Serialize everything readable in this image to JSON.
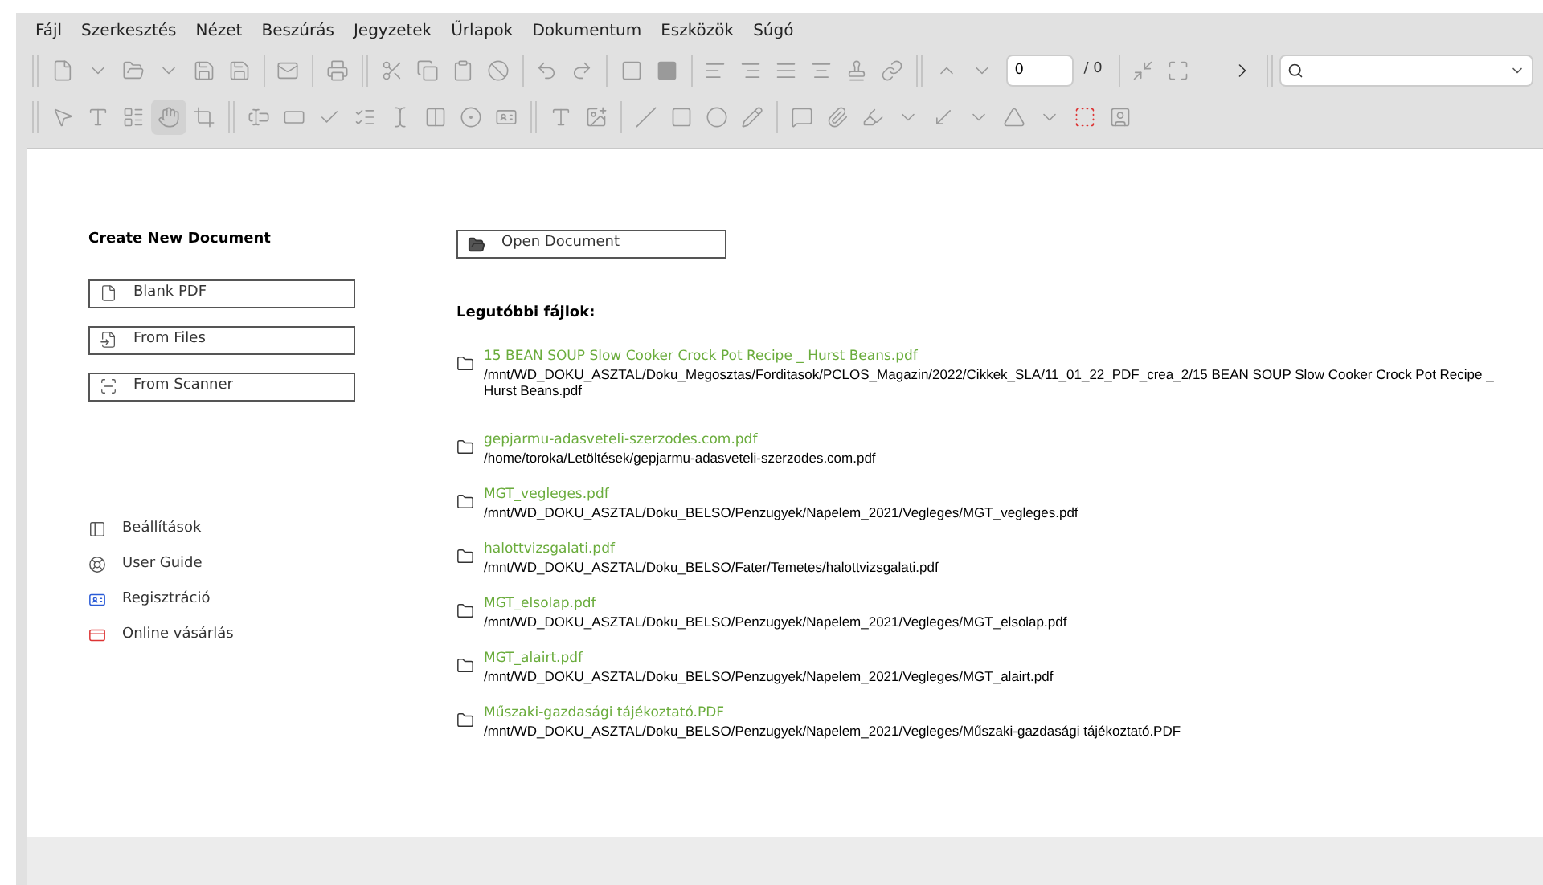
{
  "menu_bar": [
    "Fájl",
    "Szerkesztés",
    "Nézet",
    "Beszúrás",
    "Jegyzetek",
    "Űrlapok",
    "Dokumentum",
    "Eszközök",
    "Súgó"
  ],
  "toolbar": {
    "page_field": {
      "value": "0"
    },
    "page_total": "/ 0"
  },
  "create": {
    "title": "Create New Document",
    "buttons": [
      {
        "label": "Blank PDF",
        "kind": "blank"
      },
      {
        "label": "From Files",
        "kind": "files"
      },
      {
        "label": "From Scanner",
        "kind": "scanner"
      }
    ]
  },
  "links": [
    {
      "label": "Beállítások",
      "kind": "settings"
    },
    {
      "label": "User Guide",
      "kind": "guide"
    },
    {
      "label": "Regisztráció",
      "kind": "register"
    },
    {
      "label": "Online vásárlás",
      "kind": "buy"
    }
  ],
  "open_button": "Open Document",
  "recent": {
    "title": "Legutóbbi fájlok:",
    "files": [
      {
        "name": "15 BEAN SOUP Slow Cooker Crock Pot Recipe _ Hurst Beans.pdf",
        "path": "/mnt/WD_DOKU_ASZTAL/Doku_Megosztas/Forditasok/PCLOS_Magazin/2022/Cikkek_SLA/11_01_22_PDF_crea_2/15 BEAN SOUP Slow Cooker Crock Pot Recipe _ Hurst Beans.pdf"
      },
      {
        "name": "gepjarmu-adasveteli-szerzodes.com.pdf",
        "path": "/home/toroka/Letöltések/gepjarmu-adasveteli-szerzodes.com.pdf"
      },
      {
        "name": "MGT_vegleges.pdf",
        "path": "/mnt/WD_DOKU_ASZTAL/Doku_BELSO/Penzugyek/Napelem_2021/Vegleges/MGT_vegleges.pdf"
      },
      {
        "name": "halottvizsgalati.pdf",
        "path": "/mnt/WD_DOKU_ASZTAL/Doku_BELSO/Fater/Temetes/halottvizsgalati.pdf"
      },
      {
        "name": "MGT_elsolap.pdf",
        "path": "/mnt/WD_DOKU_ASZTAL/Doku_BELSO/Penzugyek/Napelem_2021/Vegleges/MGT_elsolap.pdf"
      },
      {
        "name": "MGT_alairt.pdf",
        "path": "/mnt/WD_DOKU_ASZTAL/Doku_BELSO/Penzugyek/Napelem_2021/Vegleges/MGT_alairt.pdf"
      },
      {
        "name": "Műszaki-gazdasági tájékoztató.PDF",
        "path": "/mnt/WD_DOKU_ASZTAL/Doku_BELSO/Penzugyek/Napelem_2021/Vegleges/Műszaki-gazdasági tájékoztató.PDF"
      }
    ]
  }
}
